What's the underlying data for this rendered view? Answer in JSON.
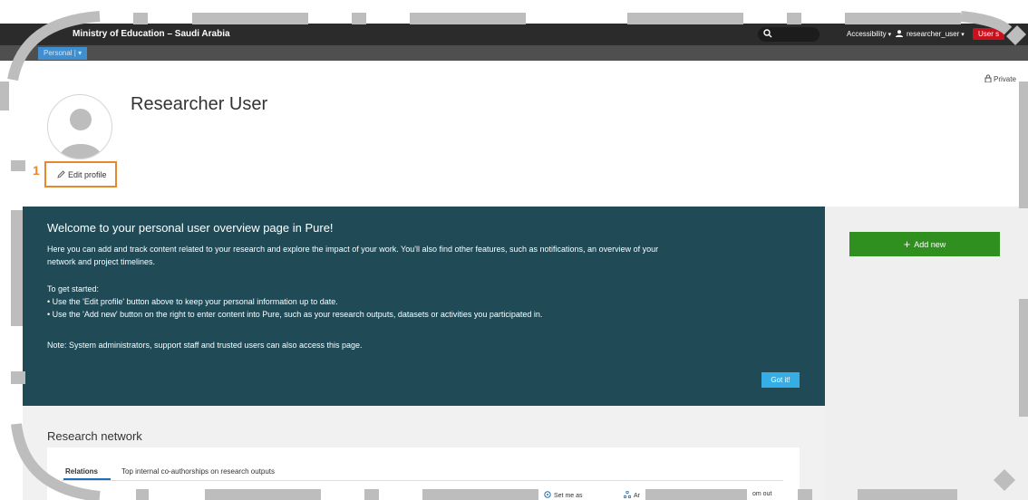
{
  "topbar": {
    "brand": "Ministry of Education – Saudi Arabia",
    "search_placeholder": "",
    "accessibility": "Accessibility",
    "username": "researcher_user",
    "user_badge": "User s"
  },
  "subbar": {
    "tab": "Personal"
  },
  "profile": {
    "private_label": "Private",
    "name": "Researcher User",
    "step_number": "1",
    "edit_label": "Edit profile"
  },
  "welcome": {
    "heading": "Welcome to your personal user overview page in Pure!",
    "intro_line1": "Here you can add and track content related to your research and explore the impact of your work. You'll also find other features, such as notifications, an overview of your",
    "intro_line2": "network and project timelines.",
    "get_started": "To get started:",
    "bullet1": "• Use the 'Edit profile' button above to keep your personal information up to date.",
    "bullet2": "• Use the 'Add new' button on the right to enter content into Pure, such as your research outputs, datasets or activities you participated in.",
    "note": "Note: System administrators, support staff and trusted users can also access this page.",
    "got_it": "Got it!"
  },
  "sidebar": {
    "add_new": "Add new"
  },
  "network": {
    "title": "Research network",
    "tabs": [
      "Relations",
      "Top internal co-authorships on research outputs"
    ],
    "buttons": [
      "Set me as",
      "Ar",
      "om out"
    ]
  },
  "colors": {
    "topbar": "#2b2b2b",
    "welcome_bg": "#1f4a56",
    "accent_orange": "#e8872b",
    "add_green": "#2f8f1f",
    "got_it_blue": "#36aee5",
    "badge_red": "#c9101d"
  }
}
